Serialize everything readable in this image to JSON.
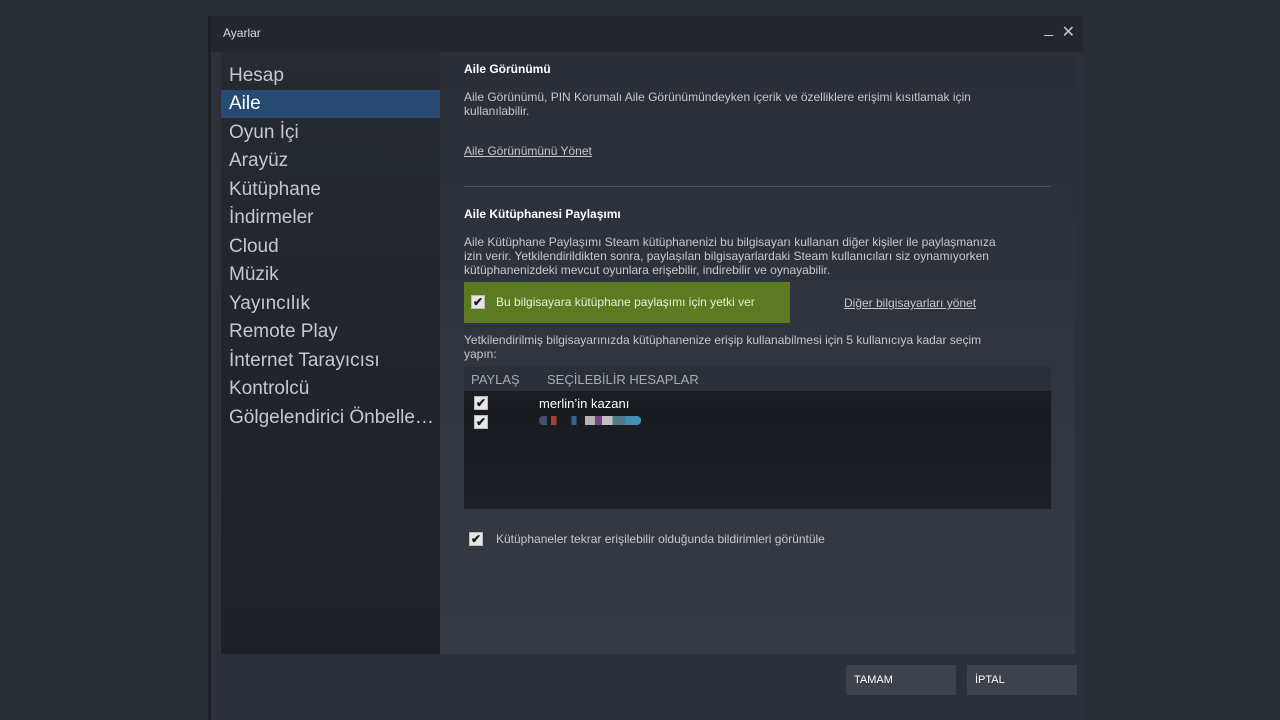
{
  "window": {
    "title": "Ayarlar",
    "minimize": "_",
    "close": "✕"
  },
  "sidebar": {
    "items": [
      {
        "label": "Hesap"
      },
      {
        "label": "Aile"
      },
      {
        "label": "Oyun İçi"
      },
      {
        "label": "Arayüz"
      },
      {
        "label": "Kütüphane"
      },
      {
        "label": "İndirmeler"
      },
      {
        "label": "Cloud"
      },
      {
        "label": "Müzik"
      },
      {
        "label": "Yayıncılık"
      },
      {
        "label": "Remote Play"
      },
      {
        "label": "İnternet Tarayıcısı"
      },
      {
        "label": "Kontrolcü"
      },
      {
        "label": "Gölgelendirici Önbellek..."
      }
    ],
    "active_index": 1
  },
  "family_view": {
    "heading": "Aile Görünümü",
    "description_line1": "Aile Görünümü, PIN Korumalı Aile Görünümündeyken içerik ve özelliklere erişimi kısıtlamak için",
    "description_line2": "kullanılabilir.",
    "manage_link": "Aile Görünümünü Yönet"
  },
  "library_sharing": {
    "heading": "Aile Kütüphanesi Paylaşımı",
    "description_line1": "Aile Kütüphane Paylaşımı Steam kütüphanenizi bu bilgisayarı kullanan diğer kişiler ile paylaşmanıza",
    "description_line2": "izin verir. Yetkilendirildikten sonra, paylaşılan bilgisayarlardaki Steam kullanıcıları siz oynamıyorken",
    "description_line3": "kütüphanenizdeki mevcut oyunlara erişebilir, indirebilir ve oynayabilir.",
    "authorize_label": "Bu bilgisayara kütüphane paylaşımı için yetki ver",
    "authorize_checked": "✔",
    "manage_other_link": "Diğer bilgisayarları yönet",
    "select_text_line1": "Yetkilendirilmiş bilgisayarınızda kütüphanenize erişip kullanabilmesi için 5 kullanıcıya kadar seçim",
    "select_text_line2": "yapın:",
    "table": {
      "col_share": "PAYLAŞ",
      "col_accounts": "SEÇİLEBİLİR HESAPLAR",
      "rows": [
        {
          "checked": "✔",
          "name": "merlin’in kazanı"
        },
        {
          "checked": "✔",
          "name": ""
        }
      ]
    },
    "notify_label": "Kütüphaneler tekrar erişilebilir olduğunda bildirimleri görüntüle",
    "notify_checked": "✔"
  },
  "buttons": {
    "ok": "TAMAM",
    "cancel": "İPTAL"
  },
  "colors": {
    "active_nav": "#264a72",
    "authorize_highlight": "#5c7a1f"
  }
}
